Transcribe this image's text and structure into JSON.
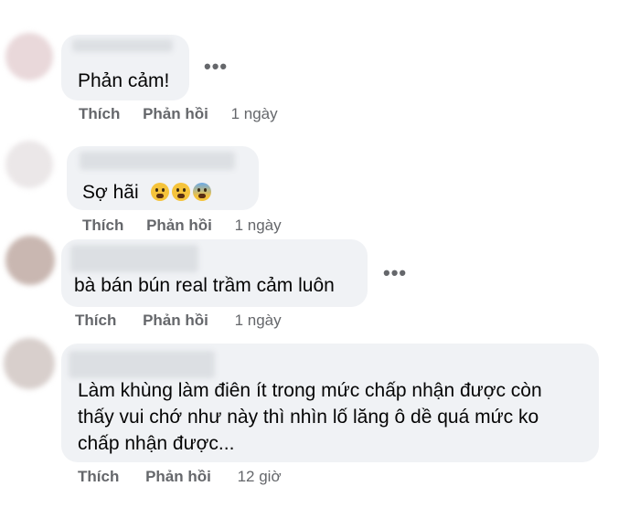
{
  "comments": [
    {
      "text": "Phản cảm!",
      "actions": {
        "like": "Thích",
        "reply": "Phản hồi",
        "time": "1 ngày"
      }
    },
    {
      "text": "Sợ hãi",
      "emojis": [
        "fearful-face-icon",
        "screaming-face-icon",
        "cold-sweat-face-icon"
      ],
      "actions": {
        "like": "Thích",
        "reply": "Phản hồi",
        "time": "1 ngày"
      }
    },
    {
      "text": "bà bán bún real trầm cảm luôn",
      "actions": {
        "like": "Thích",
        "reply": "Phản hồi",
        "time": "1 ngày"
      }
    },
    {
      "text_lines": [
        "Làm khùng làm điên ít trong mức chấp nhận được còn",
        "thấy vui chớ như này thì nhìn lố lăng ô dề quá mức ko",
        "chấp nhận được..."
      ],
      "actions": {
        "like": "Thích",
        "reply": "Phản hồi",
        "time": "12 giờ"
      }
    }
  ],
  "more_options_label": "•••",
  "colors": {
    "bubble": "#f0f2f5",
    "meta": "#65676b",
    "text": "#050505"
  }
}
